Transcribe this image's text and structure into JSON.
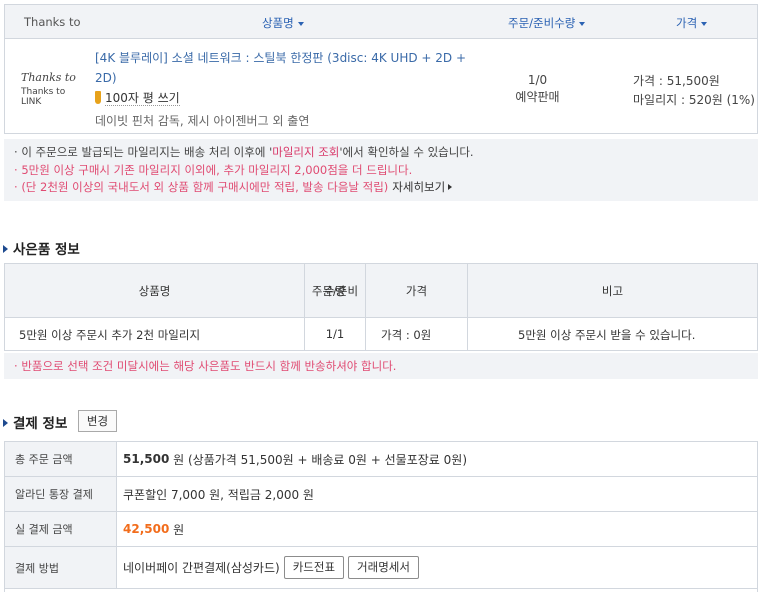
{
  "order": {
    "headers": {
      "thanks": "Thanks to",
      "name": "상품명",
      "qty": "주문/준비수량",
      "price": "가격"
    },
    "thanks_logo": {
      "line1": "Thanks to",
      "line2": "Thanks to LINK"
    },
    "product": {
      "title": "[4K 블루레이] 소셜 네트워크 : 스틸북 한정판 (3disc: 4K UHD + 2D + 2D)",
      "review_label": "100자 평 쓰기",
      "credits": "데이빗 핀처 감독, 제시 아이젠버그 외 출연",
      "qty": "1/0",
      "status": "예약판매",
      "price_line": "가격 : 51,500원",
      "mileage_line": "마일리지 : 520원 (1%)"
    },
    "notes": {
      "line1_a": "이 주문으로 발급되는 마일리지는 배송 처리 이후에 '",
      "line1_link": "마일리지 조회",
      "line1_b": "'에서 확인하실 수 있습니다.",
      "line2": "5만원 이상 구매시 기존 마일리지 이외에, 추가 마일리지 2,000점을 더 드립니다.",
      "line3": "(단 2천원 이상의 국내도서 외 상품 함께 구매시에만 적립, 발송 다음날 적립)",
      "more": "자세히보기"
    }
  },
  "gift": {
    "title": "사은품 정보",
    "headers": {
      "name": "상품명",
      "qty_1": "주문/준비",
      "qty_2": "수량",
      "price": "가격",
      "remark": "비고"
    },
    "row": {
      "name": "5만원 이상 주문시 추가 2천 마일리지",
      "qty": "1/1",
      "price": "가격 : 0원",
      "remark": "5만원 이상 주문시 받을 수 있습니다."
    },
    "note": "반품으로 선택 조건 미달시에는 해당 사은품도 반드시 함께 반송하셔야 합니다."
  },
  "payment": {
    "title": "결제 정보",
    "change_label": "변경",
    "rows": {
      "total_label": "총 주문 금액",
      "total_amount": "51,500",
      "total_rest": " 원 (상품가격 51,500원 + 배송료 0원 + 선물포장료 0원)",
      "aladin_label": "알라딘 통장 결제",
      "aladin_value": "쿠폰할인 7,000 원, 적립금 2,000 원",
      "actual_label": "실 결제 금액",
      "actual_amount": "42,500",
      "actual_unit": " 원",
      "method_label": "결제 방법",
      "method_value": "네이버페이 간편결제(삼성카드)",
      "card_receipt": "카드전표",
      "statement": "거래명세서"
    }
  }
}
